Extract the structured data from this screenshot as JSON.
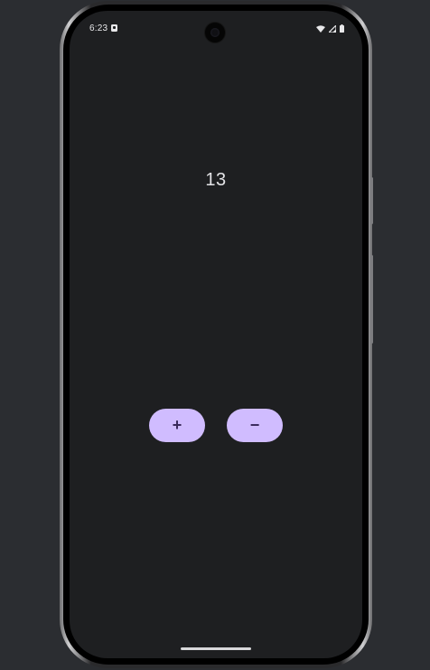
{
  "status_bar": {
    "time": "6:23",
    "notification_icon": "app-notification-icon",
    "wifi_icon": "wifi-icon",
    "signal_icon": "cell-signal-icon",
    "battery_icon": "battery-icon"
  },
  "counter": {
    "value": "13"
  },
  "controls": {
    "increment_label": "+",
    "decrement_label": "−"
  },
  "colors": {
    "screen_background": "#1e1f21",
    "button_background": "#d0bcff",
    "button_text": "#3a2a5c",
    "counter_text": "#e3e3e6"
  }
}
